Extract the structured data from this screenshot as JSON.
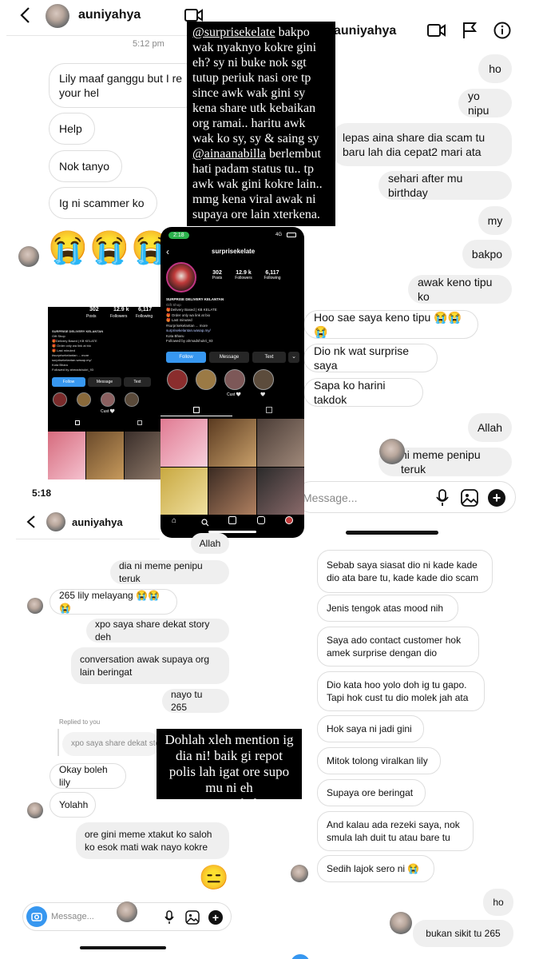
{
  "top_left": {
    "username": "auniyahya",
    "timestamp": "5:12 pm",
    "messages_received": [
      "Lily maaf ganggu but I re",
      "your hel",
      "Nok tanyo",
      "Ig ni scammer ko"
    ],
    "message_sent_help": "Help",
    "emojis": [
      "😭",
      "😭",
      "😭"
    ]
  },
  "story_text_top": {
    "mention1": "@surprisekelate",
    "line_a": " bakpo wak nyaknyo kokre gini eh? sy ni buke nok sgt tutup periuk nasi ore tp since awk wak gini sy kena share utk kebaikan org ramai.. haritu awk wak ko sy, sy & saing sy ",
    "mention2": "@ainaanabilla",
    "line_b": " berlembut hati padam status tu.. tp awk wak gini kokre lain.. mmg kena viral awak ni supaya ore lain xterkena."
  },
  "top_right": {
    "username": "auniyahya",
    "messages": [
      {
        "text": "ho",
        "side": "received"
      },
      {
        "text": "yo nipu",
        "side": "received"
      },
      {
        "text": "lepas aina share dia scam tu baru lah dia cepat2 mari ata",
        "side": "received"
      },
      {
        "text": "sehari after mu birthday",
        "side": "received"
      },
      {
        "text": "my",
        "side": "received"
      },
      {
        "text": "bakpo",
        "side": "received"
      },
      {
        "text": "awak keno tipu ko",
        "side": "received"
      },
      {
        "text": "Hoo sae saya keno tipu 😭😭😭",
        "side": "sent"
      },
      {
        "text": "Dio nk wat surprise saya",
        "side": "sent"
      },
      {
        "text": "Sapa ko harini takdok",
        "side": "sent"
      },
      {
        "text": "Allah",
        "side": "received"
      },
      {
        "text": "ni meme penipu teruk",
        "side": "received"
      }
    ],
    "composer_placeholder": "Message..."
  },
  "profile": {
    "status_time": "2:18",
    "network": "4G",
    "username": "surprisekelate",
    "stats": [
      {
        "value": "302",
        "label": "Posts"
      },
      {
        "value": "12.9 k",
        "label": "Followers"
      },
      {
        "value": "6,117",
        "label": "Following"
      }
    ],
    "bio_name": "SURPRISE DELIVERY KELANTAN",
    "bio_lines": [
      "Gift Shop",
      "🎁Delivery Based | KB KELATE",
      "🎁 Order only wa link at bio",
      "🎁 Last minuted",
      "#surprisekelantan ... more",
      "surprisekelantan.wasap.my/",
      "Kota Bharu",
      "Followed by ahmadshukri_93"
    ],
    "buttons": [
      "Follow",
      "Message",
      "Text"
    ],
    "highlights": [
      "",
      "",
      "Cust 🤍",
      "🤍"
    ],
    "small_stats": [
      "302",
      "12.9 k",
      "6,117"
    ],
    "small_labels": [
      "Posts",
      "Followers",
      "Following"
    ]
  },
  "bottom_left": {
    "status_time": "5:18",
    "username": "auniyahya",
    "messages": [
      {
        "text": "Allah",
        "side": "received"
      },
      {
        "text": "dia ni meme penipu teruk",
        "side": "received"
      },
      {
        "text": "265 lily melayang 😭😭😭",
        "side": "sent"
      },
      {
        "text": "xpo saya share dekat story deh",
        "side": "received"
      },
      {
        "text": "conversation awak supaya org lain beringat",
        "side": "received"
      },
      {
        "text": "nayo tu 265",
        "side": "received"
      },
      {
        "text": "Okay boleh lily",
        "side": "sent"
      },
      {
        "text": "Yolahh",
        "side": "sent"
      },
      {
        "text": "ore gini meme xtakut ko saloh ko esok mati wak nayo kokre",
        "side": "received"
      }
    ],
    "replied_label": "Replied to you",
    "replied_quote": "xpo saya share dekat sto",
    "emoji_end": "😑",
    "composer_placeholder": "Message..."
  },
  "story_text_bottom": {
    "text": "Dohlah xleh mention ig dia ni! baik gi repot polis lah igat ore supo mu ni eh ",
    "mention": "@surprisekelate"
  },
  "bottom_right": {
    "messages": [
      {
        "text": "Sebab saya siasat dio ni kade kade dio ata bare tu, kade kade dio scam",
        "side": "sent"
      },
      {
        "text": "Jenis tengok atas mood nih",
        "side": "sent"
      },
      {
        "text": "Saya ado contact customer hok amek surprise dengan dio",
        "side": "sent"
      },
      {
        "text": "Dio kata hoo yolo doh ig tu gapo. Tapi hok cust tu dio molek jah ata",
        "side": "sent"
      },
      {
        "text": "Hok saya ni jadi gini",
        "side": "sent"
      },
      {
        "text": "Mitok tolong viralkan lily",
        "side": "sent"
      },
      {
        "text": "Supaya ore beringat",
        "side": "sent"
      },
      {
        "text": "And kalau ada rezeki saya, nok smula lah duit tu atau bare tu",
        "side": "sent"
      },
      {
        "text": "Sedih lajok sero ni 😭",
        "side": "sent"
      },
      {
        "text": "ho",
        "side": "received"
      },
      {
        "text": "bukan sikit tu 265",
        "side": "received"
      }
    ]
  }
}
